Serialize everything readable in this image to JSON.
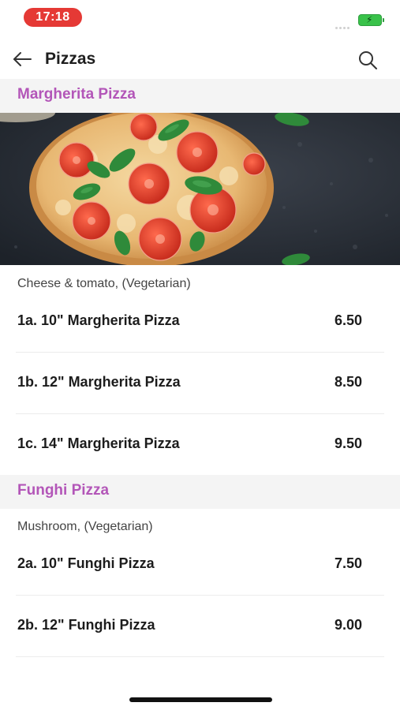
{
  "status_bar": {
    "time": "17:18",
    "time_pill_color": "#e53935",
    "battery_icon": "battery-charging-icon",
    "battery_color": "#39c24a"
  },
  "header": {
    "back_icon": "arrow-left-icon",
    "title": "Pizzas",
    "search_icon": "search-icon"
  },
  "accent_color": "#b356b8",
  "sections": [
    {
      "title": "Margherita Pizza",
      "image": "pizza-photo",
      "description": "Cheese & tomato, (Vegetarian)",
      "items": [
        {
          "name": "1a. 10\" Margherita Pizza",
          "price": "6.50"
        },
        {
          "name": "1b. 12\" Margherita Pizza",
          "price": "8.50"
        },
        {
          "name": "1c. 14\" Margherita Pizza",
          "price": "9.50"
        }
      ]
    },
    {
      "title": "Funghi Pizza",
      "description": "Mushroom, (Vegetarian)",
      "items": [
        {
          "name": "2a. 10\" Funghi Pizza",
          "price": "7.50"
        },
        {
          "name": "2b. 12\" Funghi Pizza",
          "price": "9.00"
        }
      ]
    }
  ]
}
